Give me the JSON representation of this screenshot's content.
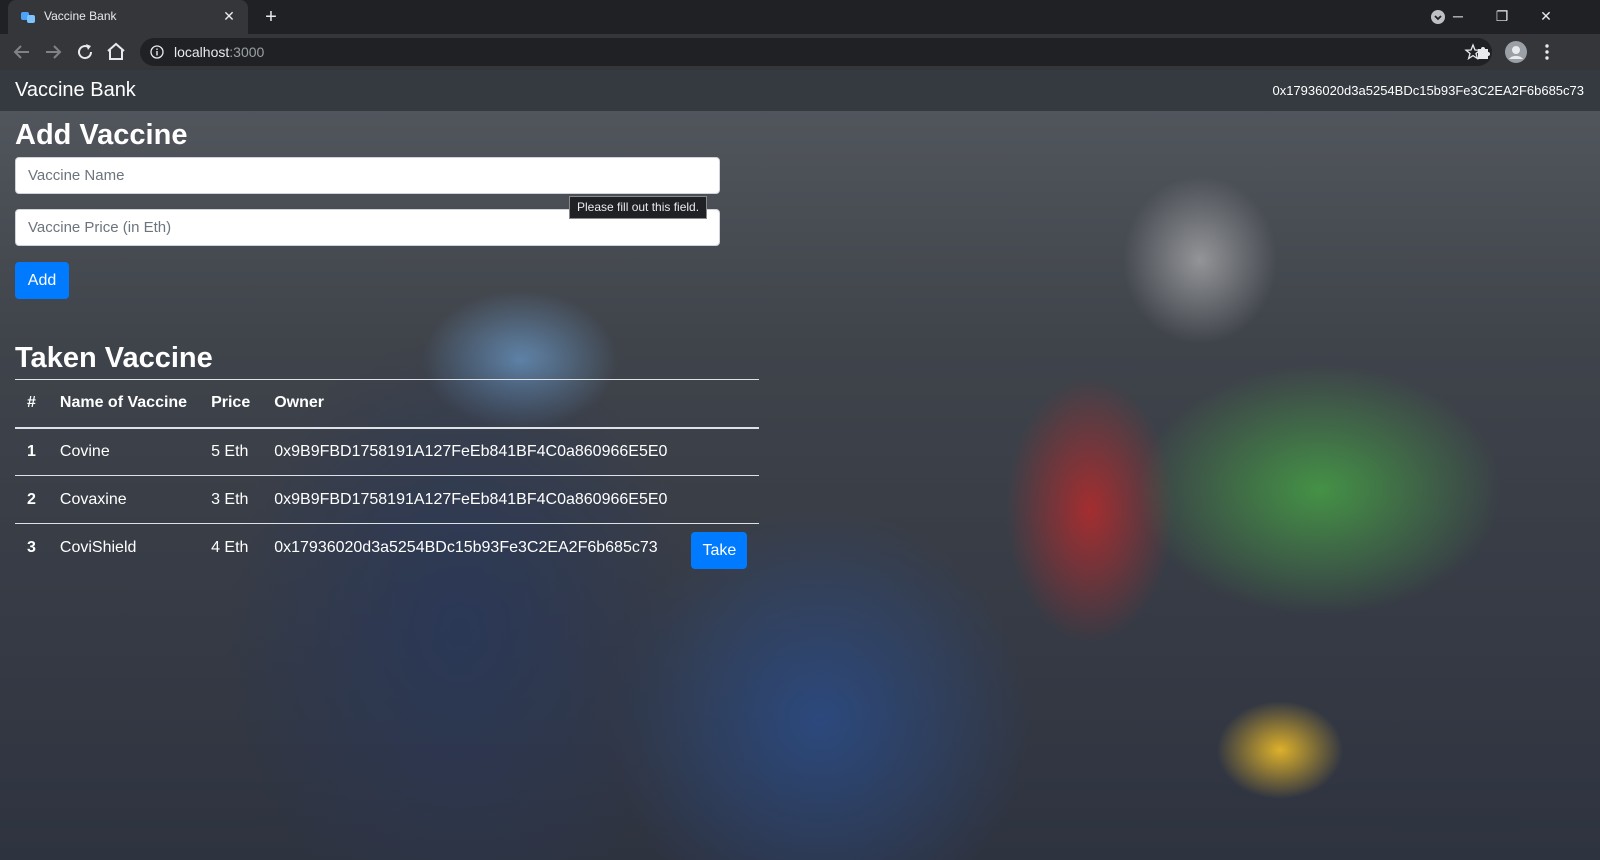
{
  "browser": {
    "tab_title": "Vaccine Bank",
    "tab_close": "✕",
    "new_tab": "+",
    "url_host": "localhost",
    "url_port": ":3000",
    "window_controls": {
      "minimize": "─",
      "restore": "❐",
      "close": "✕"
    }
  },
  "navbar": {
    "brand": "Vaccine Bank",
    "account": "0x17936020d3a5254BDc15b93Fe3C2EA2F6b685c73"
  },
  "add_form": {
    "heading": "Add Vaccine",
    "name_placeholder": "Vaccine Name",
    "price_placeholder": "Vaccine Price (in Eth)",
    "add_label": "Add",
    "validation_tooltip": "Please fill out this field."
  },
  "taken": {
    "heading": "Taken Vaccine",
    "columns": [
      "#",
      "Name of Vaccine",
      "Price",
      "Owner"
    ],
    "rows": [
      {
        "id": "1",
        "name": "Covine",
        "price": "5 Eth",
        "owner": "0x9B9FBD1758191A127FeEb841BF4C0a860966E5E0",
        "action": ""
      },
      {
        "id": "2",
        "name": "Covaxine",
        "price": "3 Eth",
        "owner": "0x9B9FBD1758191A127FeEb841BF4C0a860966E5E0",
        "action": ""
      },
      {
        "id": "3",
        "name": "CoviShield",
        "price": "4 Eth",
        "owner": "0x17936020d3a5254BDc15b93Fe3C2EA2F6b685c73",
        "action": "Take"
      }
    ]
  },
  "colors": {
    "primary": "#007bff",
    "navbar": "#343a40",
    "chrome_dark": "#202124",
    "chrome_toolbar": "#35363a"
  },
  "icons": {
    "favicon": "vaccine-favicon-icon",
    "back": "arrow-left-icon",
    "forward": "arrow-right-icon",
    "reload": "reload-icon",
    "home": "home-icon",
    "site_info": "info-icon",
    "bookmark": "star-icon",
    "extensions": "puzzle-icon",
    "profile": "avatar",
    "menu": "kebab-menu-icon",
    "tab_search": "tab-search-icon"
  }
}
